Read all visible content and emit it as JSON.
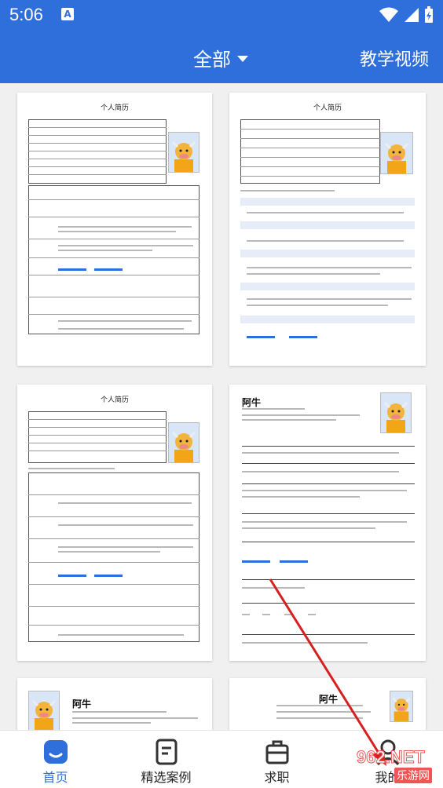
{
  "status_bar": {
    "time": "5:06",
    "notif_icon": "A"
  },
  "app_bar": {
    "title": "全部",
    "right_link": "教学视频"
  },
  "cards": [
    {
      "title": "个人简历"
    },
    {
      "title": "个人简历"
    },
    {
      "title": "个人简历"
    },
    {
      "name": "阿牛"
    },
    {
      "name": "阿牛"
    },
    {
      "name": "阿牛"
    }
  ],
  "bottom_nav": [
    {
      "label": "首页",
      "icon": "home-icon"
    },
    {
      "label": "精选案例",
      "icon": "document-icon"
    },
    {
      "label": "求职",
      "icon": "briefcase-icon"
    },
    {
      "label": "我的",
      "icon": "person-icon"
    }
  ],
  "watermark": {
    "big": "962.NET",
    "small": "乐游网"
  },
  "colors": {
    "primary": "#2f6fdc",
    "annotation_arrow": "#d62020"
  }
}
